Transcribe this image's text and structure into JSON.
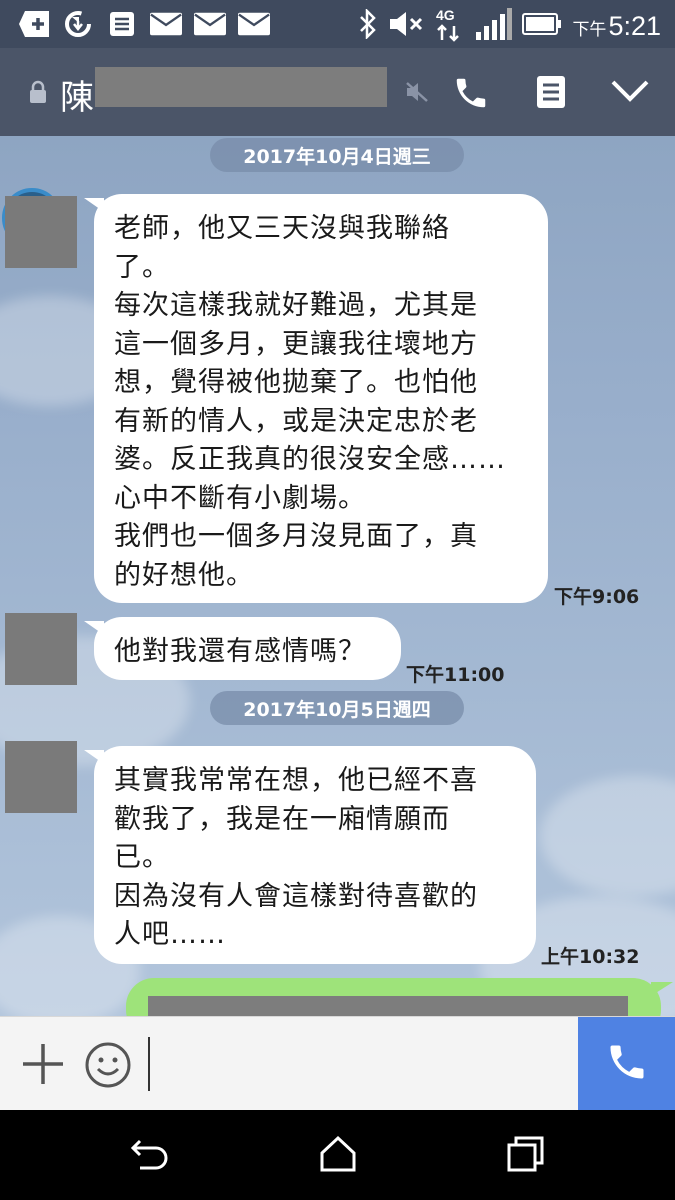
{
  "status_bar": {
    "ampm": "下午",
    "time": "5:21",
    "network": "4G"
  },
  "header": {
    "title_char": "陳"
  },
  "chat": {
    "dates": [
      "2017年10月4日週三",
      "2017年10月5日週四"
    ],
    "messages": [
      {
        "text": "老師，他又三天沒與我聯絡\n了。\n每次這樣我就好難過，尤其是\n這一個多月，更讓我往壞地方\n想，覺得被他拋棄了。也怕他\n有新的情人，或是決定忠於老\n婆。反正我真的很沒安全感……\n心中不斷有小劇場。\n我們也一個多月沒見面了，真\n的好想他。",
        "time": "下午9:06"
      },
      {
        "text": "他對我還有感情嗎？",
        "time": "下午11:00"
      },
      {
        "text": "其實我常常在想，他已經不喜\n歡我了，我是在一廂情願而\n已。\n因為沒有人會這樣對待喜歡的\n人吧……",
        "time": "上午10:32"
      }
    ]
  },
  "input": {
    "placeholder": ""
  },
  "colors": {
    "status_bar": "#3f4a5e",
    "header": "#4b5568",
    "outgoing_bubble": "#9ee37a",
    "call_button": "#4f82e3"
  }
}
